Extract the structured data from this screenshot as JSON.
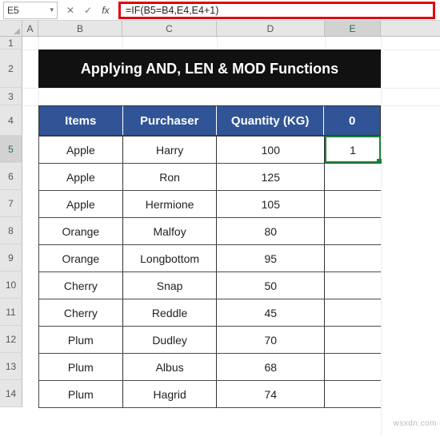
{
  "formula_bar": {
    "cell_ref": "E5",
    "formula": "=IF(B5=B4,E4,E4+1)",
    "fx_label": "fx",
    "cancel_icon": "✕",
    "accept_icon": "✓",
    "dropdown_icon": "▾"
  },
  "columns": [
    "A",
    "B",
    "C",
    "D",
    "E"
  ],
  "rows": [
    "1",
    "2",
    "3",
    "4",
    "5",
    "6",
    "7",
    "8",
    "9",
    "10",
    "11",
    "12",
    "13",
    "14"
  ],
  "active": {
    "col": "E",
    "row": "5"
  },
  "title": "Applying AND, LEN & MOD Functions",
  "headers": {
    "items": "Items",
    "purchaser": "Purchaser",
    "quantity": "Quantity (KG)",
    "extra": "0"
  },
  "data_rows": [
    {
      "items": "Apple",
      "purchaser": "Harry",
      "quantity": "100",
      "extra": "1"
    },
    {
      "items": "Apple",
      "purchaser": "Ron",
      "quantity": "125",
      "extra": ""
    },
    {
      "items": "Apple",
      "purchaser": "Hermione",
      "quantity": "105",
      "extra": ""
    },
    {
      "items": "Orange",
      "purchaser": "Malfoy",
      "quantity": "80",
      "extra": ""
    },
    {
      "items": "Orange",
      "purchaser": "Longbottom",
      "quantity": "95",
      "extra": ""
    },
    {
      "items": "Cherry",
      "purchaser": "Snap",
      "quantity": "50",
      "extra": ""
    },
    {
      "items": "Cherry",
      "purchaser": "Reddle",
      "quantity": "45",
      "extra": ""
    },
    {
      "items": "Plum",
      "purchaser": "Dudley",
      "quantity": "70",
      "extra": ""
    },
    {
      "items": "Plum",
      "purchaser": "Albus",
      "quantity": "68",
      "extra": ""
    },
    {
      "items": "Plum",
      "purchaser": "Hagrid",
      "quantity": "74",
      "extra": ""
    }
  ],
  "watermark": "wsxdn.com"
}
